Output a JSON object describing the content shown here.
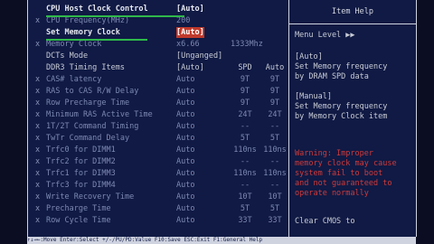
{
  "main": {
    "rows": [
      {
        "marker": "",
        "label": "CPU Host Clock Control",
        "value": "[Auto]",
        "spd": "",
        "auto": "",
        "style": "bright",
        "highlight": false
      },
      {
        "marker": "x",
        "label": "CPU Frequency(MHz)",
        "value": "200",
        "spd": "",
        "auto": "",
        "style": "dim",
        "highlight": false
      },
      {
        "marker": "",
        "label": "Set Memory Clock",
        "value": "[Auto]",
        "spd": "",
        "auto": "",
        "style": "bright",
        "highlight": true
      },
      {
        "marker": "x",
        "label": "Memory Clock",
        "value": "x6.66",
        "spd": "1333Mhz",
        "auto": "",
        "style": "dim",
        "highlight": false
      },
      {
        "marker": "",
        "label": "DCTs Mode",
        "value": "[Unganged]",
        "spd": "",
        "auto": "",
        "style": "",
        "highlight": false
      },
      {
        "marker": "",
        "label": "DDR3 Timing Items",
        "value": "[Auto]",
        "spd": "SPD",
        "auto": "Auto",
        "style": "",
        "highlight": false
      },
      {
        "marker": "x",
        "label": "CAS# latency",
        "value": "Auto",
        "spd": "9T",
        "auto": "9T",
        "style": "dim",
        "highlight": false
      },
      {
        "marker": "x",
        "label": "RAS to CAS R/W Delay",
        "value": "Auto",
        "spd": "9T",
        "auto": "9T",
        "style": "dim",
        "highlight": false
      },
      {
        "marker": "x",
        "label": "Row Precharge Time",
        "value": "Auto",
        "spd": "9T",
        "auto": "9T",
        "style": "dim",
        "highlight": false
      },
      {
        "marker": "x",
        "label": "Minimum RAS Active Time",
        "value": "Auto",
        "spd": "24T",
        "auto": "24T",
        "style": "dim",
        "highlight": false
      },
      {
        "marker": "x",
        "label": "1T/2T Command Timing",
        "value": "Auto",
        "spd": "--",
        "auto": "--",
        "style": "dim",
        "highlight": false
      },
      {
        "marker": "x",
        "label": "TwTr Command Delay",
        "value": "Auto",
        "spd": "5T",
        "auto": "5T",
        "style": "dim",
        "highlight": false
      },
      {
        "marker": "x",
        "label": "Trfc0 for DIMM1",
        "value": "Auto",
        "spd": "110ns",
        "auto": "110ns",
        "style": "dim",
        "highlight": false
      },
      {
        "marker": "x",
        "label": "Trfc2 for DIMM2",
        "value": "Auto",
        "spd": "--",
        "auto": "--",
        "style": "dim",
        "highlight": false
      },
      {
        "marker": "x",
        "label": "Trfc1 for DIMM3",
        "value": "Auto",
        "spd": "110ns",
        "auto": "110ns",
        "style": "dim",
        "highlight": false
      },
      {
        "marker": "x",
        "label": "Trfc3 for DIMM4",
        "value": "Auto",
        "spd": "--",
        "auto": "--",
        "style": "dim",
        "highlight": false
      },
      {
        "marker": "x",
        "label": "Write Recovery Time",
        "value": "Auto",
        "spd": "10T",
        "auto": "10T",
        "style": "dim",
        "highlight": false
      },
      {
        "marker": "x",
        "label": "Precharge Time",
        "value": "Auto",
        "spd": "5T",
        "auto": "5T",
        "style": "dim",
        "highlight": false
      },
      {
        "marker": "x",
        "label": "Row Cycle Time",
        "value": "Auto",
        "spd": "33T",
        "auto": "33T",
        "style": "dim",
        "highlight": false
      }
    ]
  },
  "help": {
    "title": "Item Help",
    "menu_level": "Menu Level   ▶▶",
    "lines": [
      "[Auto]",
      "Set Memory frequency",
      "by DRAM SPD data",
      "",
      "[Manual]",
      "Set Memory frequency",
      "by Memory Clock item"
    ],
    "warning": [
      "Warning: Improper",
      "memory clock may cause",
      "system fail to boot",
      "and not guaranteed to",
      "operate normally"
    ],
    "clear_cmos": "Clear CMOS to"
  },
  "footer": {
    "text": "↑↓→←:Move  Enter:Select  +/-/PU/PD:Value  F10:Save  ESC:Exit  F1:General Help"
  },
  "colors": {
    "panel_bg": "#101a44",
    "highlight_bg": "#c0392b",
    "underline": "#2fb84a",
    "warning_text": "#d03a3a"
  }
}
